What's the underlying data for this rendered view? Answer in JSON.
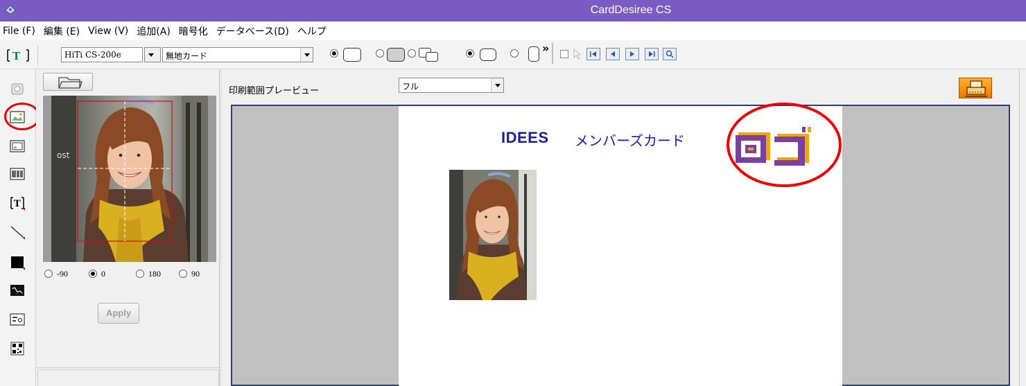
{
  "window": {
    "title": "CardDesiree CS"
  },
  "menu": [
    "File (F)",
    "編集 (E)",
    "View (V)",
    "追加(A)",
    "暗号化",
    "データベース(D)",
    "ヘルプ"
  ],
  "toolbar": {
    "printer_value": "HiTi CS-200e",
    "card_type_value": "無地カード",
    "more_label": "»"
  },
  "image_panel": {
    "rotation_options": [
      {
        "label": "-90",
        "selected": false
      },
      {
        "label": "0",
        "selected": true
      },
      {
        "label": "180",
        "selected": false
      },
      {
        "label": "90",
        "selected": false
      }
    ],
    "apply_label": "Apply"
  },
  "preview": {
    "label": "印刷範囲プレービュー",
    "mode_value": "フル"
  },
  "card": {
    "title": "IDEES",
    "title_ja": "メンバーズカード",
    "logo_text": "ロゴ"
  },
  "colors": {
    "titlebar": "#7b5cc4",
    "card_text": "#1a1aa8",
    "highlight": "#ee0000",
    "logo_purple": "#7a3fa0",
    "logo_orange": "#f2a800"
  }
}
